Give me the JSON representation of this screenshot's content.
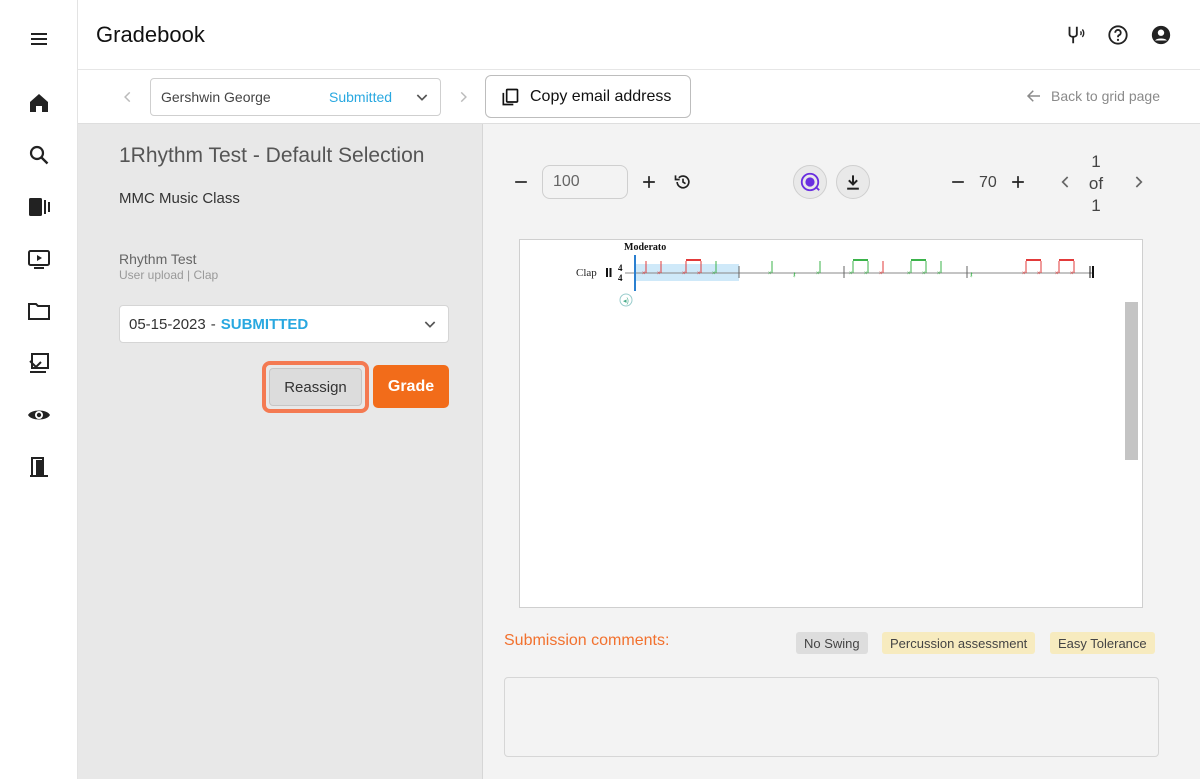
{
  "header": {
    "title": "Gradebook"
  },
  "rail": {
    "items": [
      "menu-icon",
      "home-icon",
      "search-icon",
      "library-icon",
      "video-icon",
      "folder-icon",
      "assignment-icon",
      "eye-icon",
      "exit-icon"
    ]
  },
  "subbar": {
    "student_name": "Gershwin George",
    "student_status": "Submitted",
    "copy_email_label": "Copy email address",
    "back_label": "Back to grid page"
  },
  "assignment": {
    "title": "1Rhythm Test - Default Selection",
    "class_name": "MMC Music Class",
    "test_name": "Rhythm Test",
    "test_meta": "User upload | Clap",
    "submission_date": "05-15-2023",
    "submission_sep": "-",
    "submission_status": "SUBMITTED",
    "reassign_label": "Reassign",
    "grade_label": "Grade"
  },
  "viewer": {
    "tempo_value": "100",
    "zoom_value": "70",
    "page_current": "1",
    "page_of": "of",
    "page_total": "1",
    "score": {
      "tempo_mark": "Moderato",
      "part_name": "Clap",
      "time_sig_top": "4",
      "time_sig_bottom": "4"
    }
  },
  "comments": {
    "label": "Submission comments:",
    "tags": [
      "No Swing",
      "Percussion assessment",
      "Easy Tolerance"
    ]
  },
  "colors": {
    "accent": "#f26c1a",
    "status_blue": "#29a8e0",
    "highlight_ring": "#f47a52",
    "note_red": "#e23a3a",
    "note_green": "#3bb34a"
  }
}
